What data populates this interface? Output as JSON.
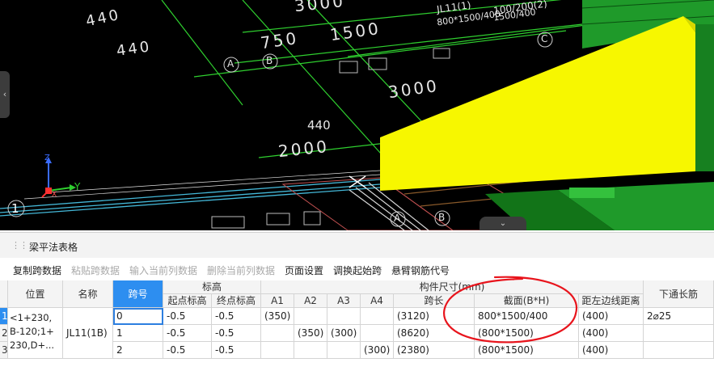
{
  "viewport": {
    "dimensions": [
      "440",
      "440",
      "750",
      "1500",
      "3000",
      "3000",
      "440",
      "2000"
    ],
    "top_texts": [
      "JL11(1)",
      "100/200(2)",
      "800*1500/400",
      "1500/400"
    ],
    "axis_labels": [
      "A",
      "B",
      "C",
      "A",
      "B"
    ],
    "axes": {
      "z": "Z",
      "y": "Y",
      "x": "X"
    },
    "index_label": "1",
    "colors": {
      "beam_yellow": "#f7f700",
      "column_green": "#1f9a2a",
      "grid_green": "#2fd02f"
    }
  },
  "panel": {
    "title": "梁平法表格"
  },
  "toolbar": {
    "buttons": [
      {
        "label": "复制跨数据",
        "enabled": true
      },
      {
        "label": "粘贴跨数据",
        "enabled": false
      },
      {
        "label": "输入当前列数据",
        "enabled": false
      },
      {
        "label": "删除当前列数据",
        "enabled": false
      },
      {
        "label": "页面设置",
        "enabled": true
      },
      {
        "label": "调换起始跨",
        "enabled": true
      },
      {
        "label": "悬臂钢筋代号",
        "enabled": true
      }
    ]
  },
  "table": {
    "headers": {
      "position": "位置",
      "name": "名称",
      "span": "跨号",
      "elevation": "标高",
      "start_elev": "起点标高",
      "end_elev": "终点标高",
      "member_size": "构件尺寸(mm)",
      "a1": "A1",
      "a2": "A2",
      "a3": "A3",
      "a4": "A4",
      "span_length": "跨长",
      "section": "截面(B*H)",
      "edge_dist": "距左边线距离",
      "through_bar": "下通长筋"
    },
    "position_value": "<1+230,\nB-120;1+\n230,D+...",
    "name_value": "JL11(1B)",
    "row_numbers": [
      "1",
      "2",
      "3"
    ],
    "rows": [
      {
        "span": "0",
        "start": "-0.5",
        "end": "-0.5",
        "a1": "(350)",
        "a2": "",
        "a3": "",
        "a4": "",
        "length": "(3120)",
        "section": "800*1500/400",
        "edge": "(400)",
        "bar": "2⌀25"
      },
      {
        "span": "1",
        "start": "-0.5",
        "end": "-0.5",
        "a1": "",
        "a2": "(350)",
        "a3": "(300)",
        "a4": "",
        "length": "(8620)",
        "section": "(800*1500)",
        "edge": "(400)",
        "bar": ""
      },
      {
        "span": "2",
        "start": "-0.5",
        "end": "-0.5",
        "a1": "",
        "a2": "",
        "a3": "",
        "a4": "(300)",
        "length": "(2380)",
        "section": "(800*1500)",
        "edge": "(400)",
        "bar": ""
      }
    ],
    "annotation_color": "#e8141c"
  }
}
